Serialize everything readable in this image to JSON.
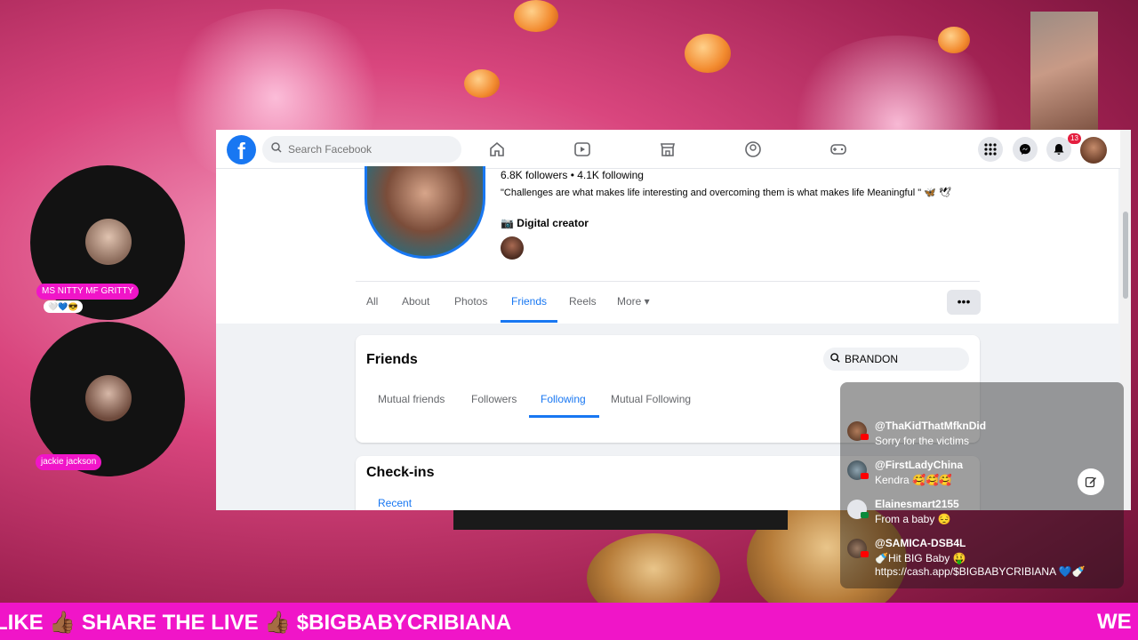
{
  "colors": {
    "fb_blue": "#1877f2",
    "ticker_bg": "#f015c8",
    "name_tag_bg": "#f015c8"
  },
  "facebook": {
    "search_placeholder": "Search Facebook",
    "notification_count": "13",
    "profile": {
      "stats": "6.8K followers • 4.1K following",
      "bio": "\"Challenges are what makes life interesting and overcoming them is what makes life Meaningful \" 🦋 🕊",
      "category": "📷 Digital creator"
    },
    "tabs": [
      "All",
      "About",
      "Photos",
      "Friends",
      "Reels",
      "More ▾"
    ],
    "active_tab": "Friends",
    "more_button": "•••",
    "friends": {
      "title": "Friends",
      "search_value": "BRANDON",
      "subtabs": [
        "Mutual friends",
        "Followers",
        "Following",
        "Mutual Following"
      ],
      "active_subtab": "Following"
    },
    "checkins": {
      "title": "Check-ins",
      "recent": "Recent"
    }
  },
  "guests": [
    {
      "name": "MS NITTY MF GRITTY",
      "emoji": "🤍💙😎"
    },
    {
      "name": "jackie jackson"
    }
  ],
  "chat": {
    "messages": [
      {
        "user": "@ThaKidThatMfknDid",
        "text": "Sorry for the victims"
      },
      {
        "user": "@FirstLadyChina",
        "text": "Kendra 🥰🥰🥰"
      },
      {
        "user": "Elainesmart2155",
        "text": "From a baby 😔"
      },
      {
        "user": "@SAMICA-DSB4L",
        "text": "🍼Hit BIG Baby 🤑",
        "link": "https://cash.app/$BIGBABYCRIBIANA 💙🍼"
      }
    ]
  },
  "ticker": {
    "text": "LIKE 👍🏾 SHARE THE LIVE 👍🏾 $BIGBABYCRIBIANA",
    "tail": "WE"
  }
}
